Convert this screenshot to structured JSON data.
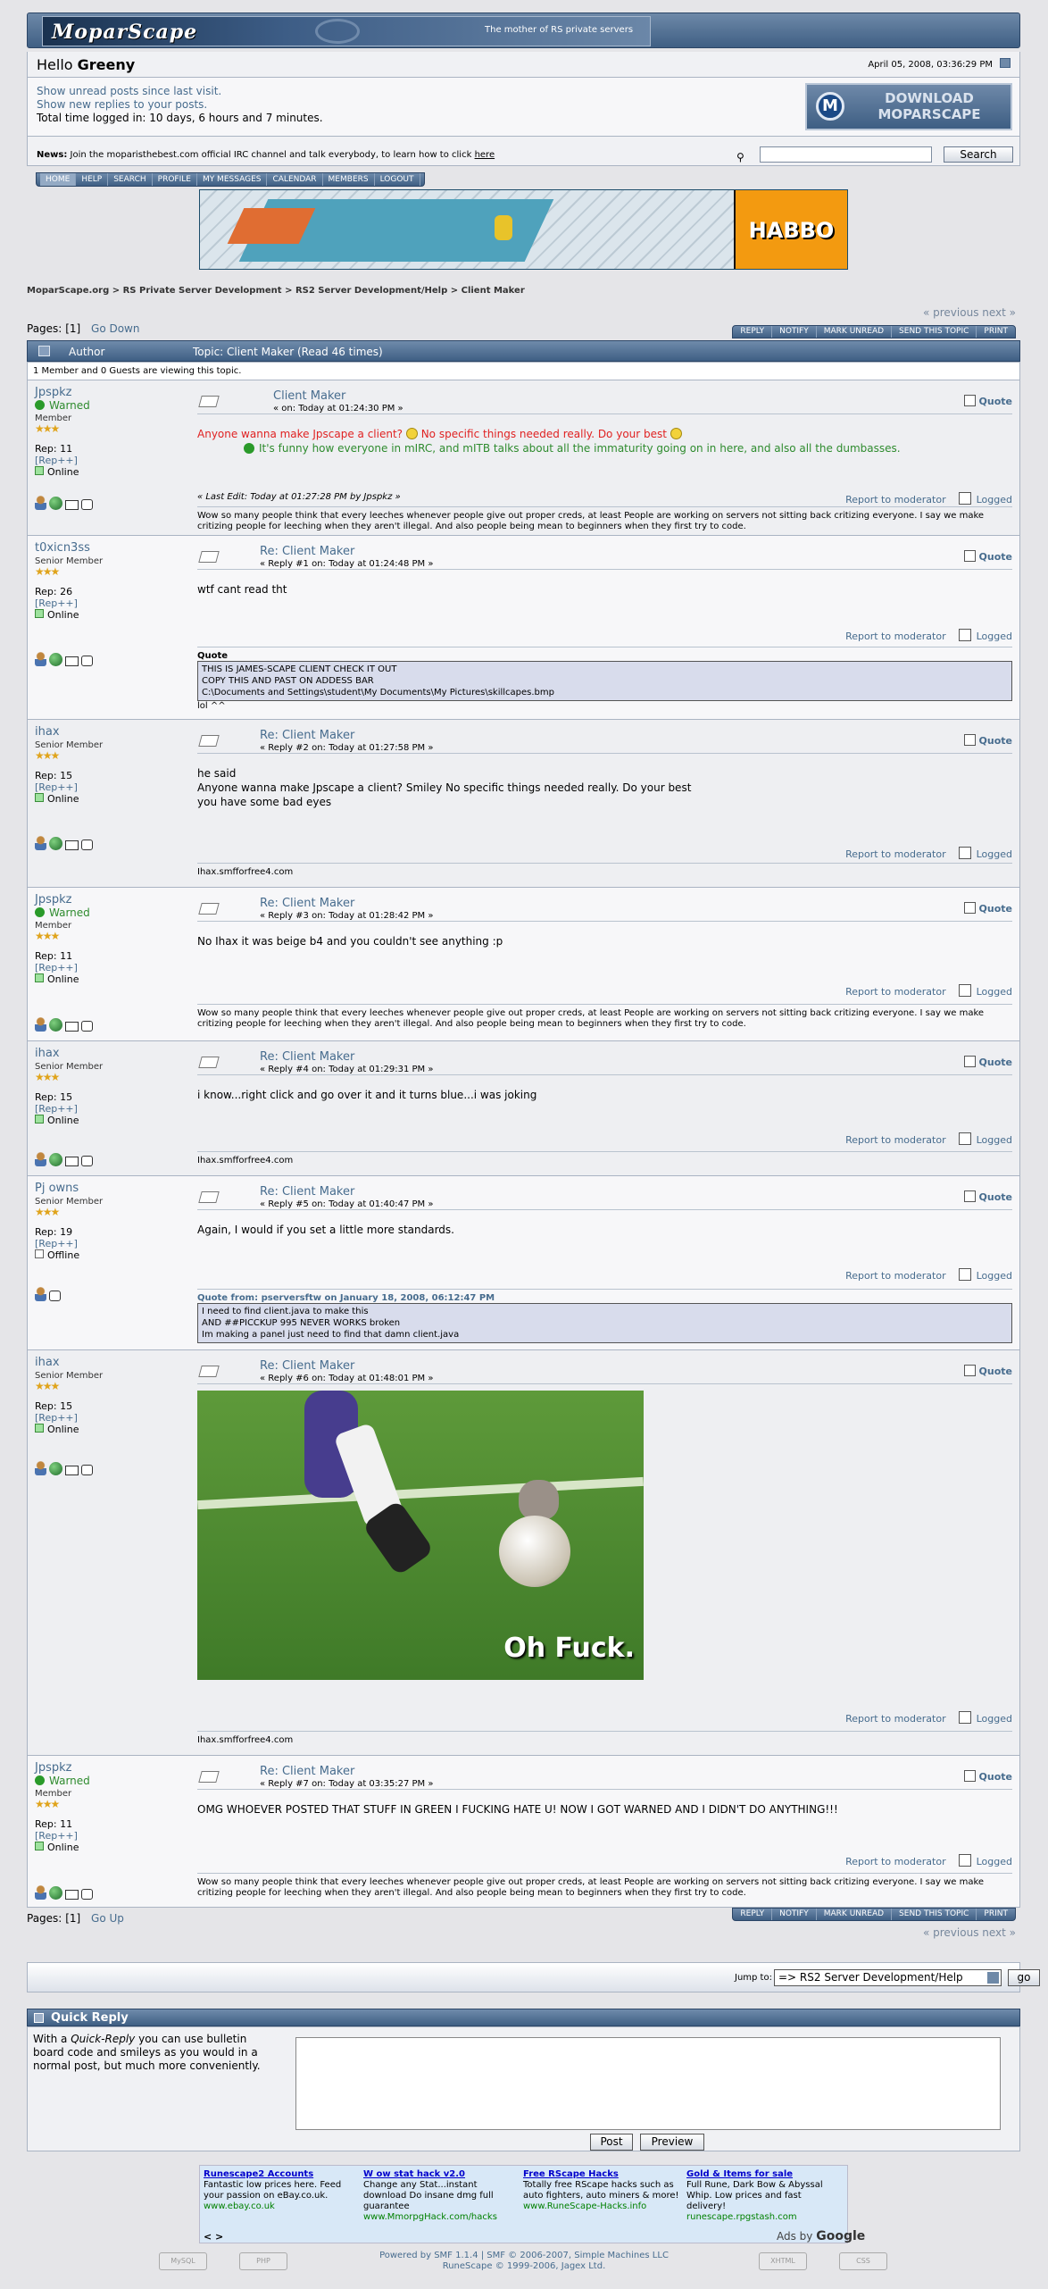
{
  "header": {
    "brand": "MoparScape",
    "tagline": "The mother of RS private servers",
    "greeting": "Hello",
    "username": "Greeny",
    "date": "April 05, 2008, 03:36:29 PM"
  },
  "info": {
    "unread": "Show unread posts since last visit.",
    "replies": "Show new replies to your posts.",
    "total_time": "Total time logged in: 10 days, 6 hours and 7 minutes.",
    "download": "DOWNLOAD MOPARSCAPE"
  },
  "news": {
    "label": "News:",
    "text": "Join the moparisthebest.com official IRC channel and talk everybody, to learn how to click",
    "link": "here",
    "search_button": "Search"
  },
  "menu": [
    "HOME",
    "HELP",
    "SEARCH",
    "PROFILE",
    "MY MESSAGES",
    "CALENDAR",
    "MEMBERS",
    "LOGOUT"
  ],
  "banner": {
    "logo": "HABBO"
  },
  "breadcrumb": [
    "MoparScape.org",
    "RS Private Server Development",
    "RS2 Server Development/Help",
    "Client Maker"
  ],
  "pagination": {
    "prev_next": "« previous next »",
    "pages_label": "Pages:",
    "current": "[1]",
    "go_down": "Go Down",
    "go_up": "Go Up"
  },
  "topic_buttons": [
    "REPLY",
    "NOTIFY",
    "MARK UNREAD",
    "SEND THIS TOPIC",
    "PRINT"
  ],
  "table": {
    "author": "Author",
    "topic": "Topic: Client Maker  (Read 46 times)",
    "viewing": "1 Member and 0 Guests are viewing this topic."
  },
  "labels": {
    "quote": "Quote",
    "report": "Report to moderator",
    "logged": "Logged",
    "rep_plus": "[Rep++]",
    "warned": "Warned",
    "online": "Online",
    "offline": "Offline",
    "stars": "★★★"
  },
  "posts": [
    {
      "user": "Jpspkz",
      "group": "Member",
      "rep": "Rep: 11",
      "title": "Client Maker",
      "meta": "« on: Today at 01:24:30 PM »",
      "line1": "Anyone wanna make Jpscape a client?",
      "line1b": "No specific things needed really. Do your best",
      "line2": "It's funny how everyone in mIRC, and mITB talks about all the immaturity going on in here, and also all the dumbasses.",
      "edit": "« Last Edit: Today at 01:27:28 PM by Jpspkz »",
      "sig": "Wow so many people think that every leeches whenever people give out proper creds, at least People are working on servers not sitting back critizing everyone. I say we make critizing people for leeching when they aren't illegal. And also people being mean to beginners when they first try to code."
    },
    {
      "user": "t0xicn3ss",
      "group": "Senior Member",
      "rep": "Rep: 26",
      "title": "Re: Client Maker",
      "meta": "« Reply #1 on: Today at 01:24:48 PM »",
      "body": "wtf cant read tht",
      "quote_head": "Quote",
      "quote_lines": [
        "THIS IS JAMES-SCAPE CLIENT CHECK IT OUT",
        "COPY THIS AND PAST ON ADDESS BAR",
        "C:\\Documents and Settings\\student\\My Documents\\My Pictures\\skillcapes.bmp"
      ],
      "after": "lol ^^"
    },
    {
      "user": "ihax",
      "group": "Senior Member",
      "rep": "Rep: 15",
      "title": "Re: Client Maker",
      "meta": "« Reply #2 on: Today at 01:27:58 PM »",
      "body_lines": [
        "he said",
        "Anyone wanna make Jpscape a client? Smiley No specific things needed really. Do your best",
        "you have some bad eyes"
      ],
      "sig": "Ihax.smfforfree4.com"
    },
    {
      "user": "Jpspkz",
      "group": "Member",
      "rep": "Rep: 11",
      "title": "Re: Client Maker",
      "meta": "« Reply #3 on: Today at 01:28:42 PM »",
      "body": "No Ihax it was beige b4 and you couldn't see anything :p",
      "sig": "Wow so many people think that every leeches whenever people give out proper creds, at least People are working on servers not sitting back critizing everyone. I say we make critizing people for leeching when they aren't illegal. And also people being mean to beginners when they first try to code."
    },
    {
      "user": "ihax",
      "group": "Senior Member",
      "rep": "Rep: 15",
      "title": "Re: Client Maker",
      "meta": "« Reply #4 on: Today at 01:29:31 PM »",
      "body": "i know...right click and go over it and it turns blue...i was joking",
      "sig": "Ihax.smfforfree4.com"
    },
    {
      "user": "Pj owns",
      "group": "Senior Member",
      "rep": "Rep: 19",
      "title": "Re: Client Maker",
      "meta": "« Reply #5 on: Today at 01:40:47 PM »",
      "body": "Again, I would if you set a little more standards.",
      "quote_head": "Quote from: pserversftw on January 18, 2008, 06:12:47 PM",
      "quote_lines": [
        "I need to find client.java to make this",
        "AND ##PICCKUP 995 NEVER WORKS broken",
        "Im making a panel just need to find that damn client.java"
      ]
    },
    {
      "user": "ihax",
      "group": "Senior Member",
      "rep": "Rep: 15",
      "title": "Re: Client Maker",
      "meta": "« Reply #6 on: Today at 01:48:01 PM »",
      "image_caption": "Oh Fuck.",
      "sig": "Ihax.smfforfree4.com"
    },
    {
      "user": "Jpspkz",
      "group": "Member",
      "rep": "Rep: 11",
      "title": "Re: Client Maker",
      "meta": "« Reply #7 on: Today at 03:35:27 PM »",
      "body": "OMG WHOEVER POSTED THAT STUFF IN GREEN I FUCKING HATE U! NOW I GOT WARNED AND I DIDN'T DO ANYTHING!!!",
      "sig": "Wow so many people think that every leeches whenever people give out proper creds, at least People are working on servers not sitting back critizing everyone. I say we make critizing people for leeching when they aren't illegal. And also people being mean to beginners when they first try to code."
    }
  ],
  "jump": {
    "label": "Jump to:",
    "selected": "=> RS2 Server Development/Help",
    "go": "go"
  },
  "quick_reply": {
    "title": "Quick Reply",
    "desc_1": "With a ",
    "desc_em": "Quick-Reply",
    "desc_2": " you can use bulletin board code and smileys as you would in a normal post, but much more conveniently.",
    "post": "Post",
    "preview": "Preview"
  },
  "ads": [
    {
      "title": "Runescape2 Accounts",
      "text": "Fantastic low prices here. Feed your passion on eBay.co.uk.",
      "url": "www.ebay.co.uk"
    },
    {
      "title": "W ow stat hack v2.0",
      "text": "Change any Stat...instant download Do insane dmg full guarantee",
      "url": "www.MmorpgHack.com/hacks"
    },
    {
      "title": "Free RScape Hacks",
      "text": "Totally free RScape hacks such as auto fighters, auto miners & more!",
      "url": "www.RuneScape-Hacks.info"
    },
    {
      "title": "Gold & Items for sale",
      "text": "Full Rune, Dark Bow & Abyssal Whip. Low prices and fast delivery!",
      "url": "runescape.rpgstash.com"
    }
  ],
  "ads_by": "Ads by",
  "google": "Google",
  "footer": {
    "line1": "Powered by SMF 1.1.4 | SMF © 2006-2007, Simple Machines LLC",
    "line2": "RuneScape © 1999-2006, Jagex Ltd."
  }
}
